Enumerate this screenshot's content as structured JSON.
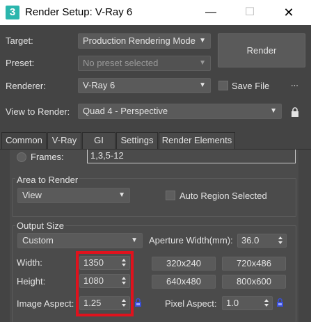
{
  "window": {
    "app_icon_text": "3",
    "title": "Render Setup: V-Ray 6",
    "minimize_glyph": "—",
    "maximize_glyph": "☐",
    "close_glyph": "✕"
  },
  "top": {
    "target_label": "Target:",
    "target_value": "Production Rendering Mode",
    "preset_label": "Preset:",
    "preset_value": "No preset selected",
    "renderer_label": "Renderer:",
    "renderer_value": "V-Ray 6",
    "save_file_label": "Save File",
    "ellipsis_label": "...",
    "render_button": "Render",
    "view_label": "View to Render:",
    "view_value": "Quad 4 - Perspective"
  },
  "tabs": [
    {
      "label": "Common"
    },
    {
      "label": "V-Ray"
    },
    {
      "label": "GI"
    },
    {
      "label": "Settings"
    },
    {
      "label": "Render Elements"
    }
  ],
  "common": {
    "frames_label": "Frames:",
    "frames_value": "1,3,5-12",
    "area_title": "Area to Render",
    "area_value": "View",
    "auto_region_label": "Auto Region Selected",
    "output_title": "Output Size",
    "output_preset": "Custom",
    "aperture_label": "Aperture Width(mm):",
    "aperture_value": "36.0",
    "width_label": "Width:",
    "width_value": "1350",
    "height_label": "Height:",
    "height_value": "1080",
    "image_aspect_label": "Image Aspect:",
    "image_aspect_value": "1.25",
    "pixel_aspect_label": "Pixel Aspect:",
    "pixel_aspect_value": "1.0",
    "presets": [
      "320x240",
      "720x486",
      "640x480",
      "800x600"
    ]
  },
  "colors": {
    "background": "#444444",
    "highlight": "#e0121d",
    "lock_blue": "#3a4fd6"
  }
}
